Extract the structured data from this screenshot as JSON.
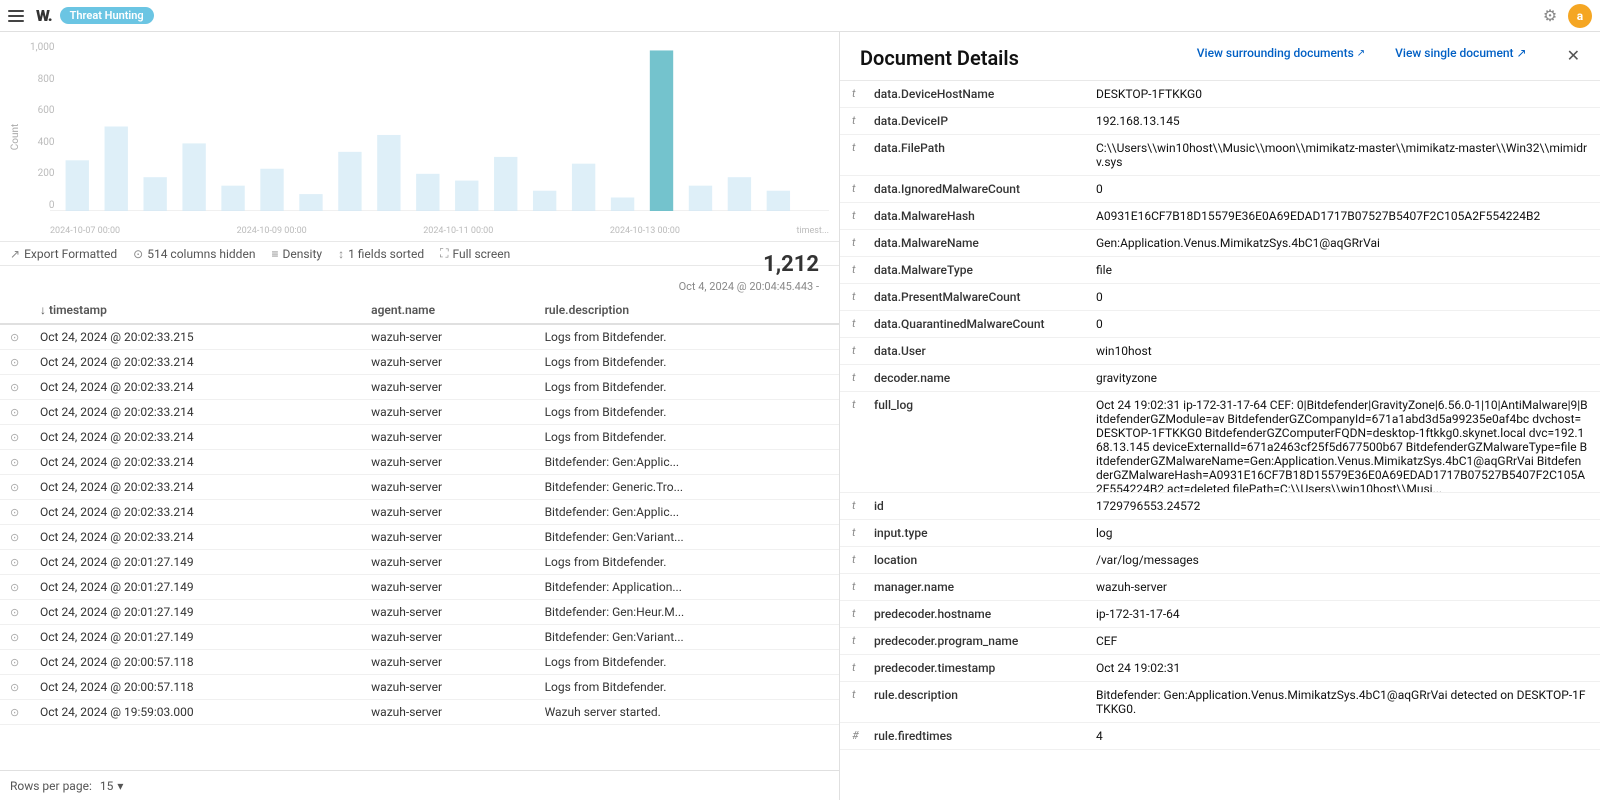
{
  "topbar": {
    "menu_label": "☰",
    "logo": "W.",
    "app_name": "Threat Hunting",
    "avatar_initial": "a",
    "settings_icon": "⚙"
  },
  "chart": {
    "y_label": "Count",
    "y_ticks": [
      "1,000",
      "800",
      "600",
      "400",
      "200",
      "0"
    ],
    "x_ticks": [
      "2024-10-07 00:00",
      "2024-10-09 00:00",
      "2024-10-11 00:00",
      "2024-10-13 00:00"
    ],
    "x_suffix": "timest..."
  },
  "toolbar": {
    "export_label": "Export Formatted",
    "columns_hidden": "514 columns hidden",
    "density_label": "Density",
    "fields_sorted": "1 fields sorted",
    "fullscreen_label": "Full screen"
  },
  "count": "1,212",
  "timestamp_note": "Oct 4, 2024 @ 20:04:45.443 -",
  "table": {
    "columns": [
      {
        "id": "timestamp",
        "label": "↓ timestamp",
        "sortable": true
      },
      {
        "id": "agent_name",
        "label": "agent.name",
        "sortable": true
      },
      {
        "id": "rule_description",
        "label": "rule.description",
        "sortable": true
      }
    ],
    "rows": [
      {
        "timestamp": "Oct 24, 2024 @ 20:02:33.215",
        "agent_name": "wazuh-server",
        "rule_description": "Logs from Bitdefender."
      },
      {
        "timestamp": "Oct 24, 2024 @ 20:02:33.214",
        "agent_name": "wazuh-server",
        "rule_description": "Logs from Bitdefender."
      },
      {
        "timestamp": "Oct 24, 2024 @ 20:02:33.214",
        "agent_name": "wazuh-server",
        "rule_description": "Logs from Bitdefender."
      },
      {
        "timestamp": "Oct 24, 2024 @ 20:02:33.214",
        "agent_name": "wazuh-server",
        "rule_description": "Logs from Bitdefender."
      },
      {
        "timestamp": "Oct 24, 2024 @ 20:02:33.214",
        "agent_name": "wazuh-server",
        "rule_description": "Logs from Bitdefender."
      },
      {
        "timestamp": "Oct 24, 2024 @ 20:02:33.214",
        "agent_name": "wazuh-server",
        "rule_description": "Bitdefender: Gen:Applic..."
      },
      {
        "timestamp": "Oct 24, 2024 @ 20:02:33.214",
        "agent_name": "wazuh-server",
        "rule_description": "Bitdefender: Generic.Tro..."
      },
      {
        "timestamp": "Oct 24, 2024 @ 20:02:33.214",
        "agent_name": "wazuh-server",
        "rule_description": "Bitdefender: Gen:Applic..."
      },
      {
        "timestamp": "Oct 24, 2024 @ 20:02:33.214",
        "agent_name": "wazuh-server",
        "rule_description": "Bitdefender: Gen:Variant..."
      },
      {
        "timestamp": "Oct 24, 2024 @ 20:01:27.149",
        "agent_name": "wazuh-server",
        "rule_description": "Logs from Bitdefender."
      },
      {
        "timestamp": "Oct 24, 2024 @ 20:01:27.149",
        "agent_name": "wazuh-server",
        "rule_description": "Bitdefender: Application..."
      },
      {
        "timestamp": "Oct 24, 2024 @ 20:01:27.149",
        "agent_name": "wazuh-server",
        "rule_description": "Bitdefender: Gen:Heur.M..."
      },
      {
        "timestamp": "Oct 24, 2024 @ 20:01:27.149",
        "agent_name": "wazuh-server",
        "rule_description": "Bitdefender: Gen:Variant..."
      },
      {
        "timestamp": "Oct 24, 2024 @ 20:00:57.118",
        "agent_name": "wazuh-server",
        "rule_description": "Logs from Bitdefender."
      },
      {
        "timestamp": "Oct 24, 2024 @ 20:00:57.118",
        "agent_name": "wazuh-server",
        "rule_description": "Logs from Bitdefender."
      },
      {
        "timestamp": "Oct 24, 2024 @ 19:59:03.000",
        "agent_name": "wazuh-server",
        "rule_description": "Wazuh server started."
      }
    ]
  },
  "bottom_bar": {
    "rows_label": "Rows per page:",
    "rows_value": "15",
    "chevron": "▾"
  },
  "doc_panel": {
    "title": "Document Details",
    "action_surrounding": "View surrounding documents",
    "action_single": "View single document ↗",
    "close_icon": "✕",
    "fields": [
      {
        "icon": "t",
        "name": "data.DeviceHostName",
        "value": "DESKTOP-1FTKKG0"
      },
      {
        "icon": "t",
        "name": "data.DeviceIP",
        "value": "192.168.13.145"
      },
      {
        "icon": "t",
        "name": "data.FilePath",
        "value": "C:\\\\Users\\\\win10host\\\\Music\\\\moon\\\\mimikatz-master\\\\mimikatz-master\\\\Win32\\\\mimidrv.sys"
      },
      {
        "icon": "t",
        "name": "data.IgnoredMalwareCount",
        "value": "0"
      },
      {
        "icon": "t",
        "name": "data.MalwareHash",
        "value": "A0931E16CF7B18D15579E36E0A69EDAD1717B07527B5407F2C105A2F554224B2"
      },
      {
        "icon": "t",
        "name": "data.MalwareName",
        "value": "Gen:Application.Venus.MimikatzSys.4bC1@aqGRrVai"
      },
      {
        "icon": "t",
        "name": "data.MalwareType",
        "value": "file"
      },
      {
        "icon": "t",
        "name": "data.PresentMalwareCount",
        "value": "0"
      },
      {
        "icon": "t",
        "name": "data.QuarantinedMalwareCount",
        "value": "0"
      },
      {
        "icon": "t",
        "name": "data.User",
        "value": "win10host"
      },
      {
        "icon": "t",
        "name": "decoder.name",
        "value": "gravityzone"
      },
      {
        "icon": "t",
        "name": "full_log",
        "value": "Oct 24 19:02:31 ip-172-31-17-64 CEF: 0|Bitdefender|GravityZone|6.56.0-1|10|AntiMalware|9|BitdefenderGZModule=av BitdefenderGZCompanyId=671a1abd3d5a99235e0af4bc dvchost=DESKTOP-1FTKKG0 BitdefenderGZComputerFQDN=desktop-1ftkkg0.skynet.local dvc=192.168.13.145 deviceExternalId=671a2463cf25f5d677500b67 BitdefenderGZMalwareType=file BitdefenderGZMalwareName=Gen:Application.Venus.MimikatzSys.4bC1@aqGRrVai BitdefenderGZMalwareHash=A0931E16CF7B18D15579E36E0A69EDAD1717B07527B5407F2C105A2F554224B2 act=deleted filePath=C:\\\\Users\\\\win10host\\\\Musi..."
      },
      {
        "icon": "t",
        "name": "id",
        "value": "1729796553.24572"
      },
      {
        "icon": "t",
        "name": "input.type",
        "value": "log"
      },
      {
        "icon": "t",
        "name": "location",
        "value": "/var/log/messages"
      },
      {
        "icon": "t",
        "name": "manager.name",
        "value": "wazuh-server"
      },
      {
        "icon": "t",
        "name": "predecoder.hostname",
        "value": "ip-172-31-17-64"
      },
      {
        "icon": "t",
        "name": "predecoder.program_name",
        "value": "CEF"
      },
      {
        "icon": "t",
        "name": "predecoder.timestamp",
        "value": "Oct 24 19:02:31"
      },
      {
        "icon": "t",
        "name": "rule.description",
        "value": "Bitdefender: Gen:Application.Venus.MimikatzSys.4bC1@aqGRrVai detected on DESKTOP-1FTKKG0."
      },
      {
        "icon": "#",
        "name": "rule.firedtimes",
        "value": "4"
      }
    ]
  }
}
